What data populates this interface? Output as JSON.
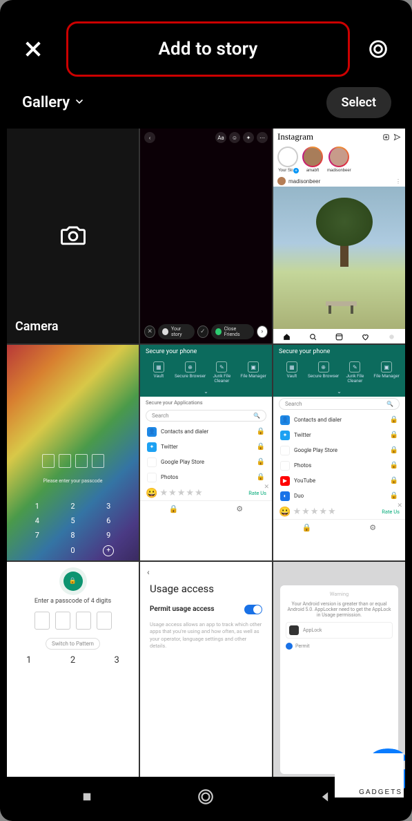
{
  "header": {
    "title": "Add to story",
    "close_icon": "close",
    "settings_icon": "settings"
  },
  "subheader": {
    "dropdown_label": "Gallery",
    "select_label": "Select"
  },
  "grid": {
    "camera": {
      "label": "Camera"
    },
    "story_editor": {
      "toolbar": [
        "Aa",
        "sticker",
        "sparkle",
        "more"
      ],
      "your_story": "Your story",
      "close_friends": "Close Friends"
    },
    "instagram_feed": {
      "brand": "Instagram",
      "icons": [
        "new-post",
        "messenger"
      ],
      "stories": [
        {
          "label": "Your Story"
        },
        {
          "label": "amabft"
        },
        {
          "label": "madisonbeer"
        }
      ],
      "post_user": "madisonbeer",
      "tabs": [
        "home",
        "search",
        "reels",
        "like",
        "profile"
      ]
    },
    "gradient_passcode": {
      "message": "Please enter your passcode",
      "keys": [
        "1",
        "2",
        "3",
        "4",
        "5",
        "6",
        "7",
        "8",
        "9",
        "",
        "0",
        "+"
      ]
    },
    "secure_a": {
      "title": "Secure your phone",
      "shortcuts": [
        {
          "label": "Vault"
        },
        {
          "label": "Secure Browser"
        },
        {
          "label": "Junk File Cleaner"
        },
        {
          "label": "File Manager"
        }
      ],
      "section": "Secure your Applications",
      "search_placeholder": "Search",
      "apps": [
        {
          "name": "Contacts and dialer",
          "color": "#1e88e5"
        },
        {
          "name": "Twitter",
          "color": "#1da1f2"
        },
        {
          "name": "Google Play Store",
          "color": "#ffffff"
        },
        {
          "name": "Photos",
          "color": "#ffffff"
        }
      ],
      "rate_label": "Rate Us"
    },
    "secure_b": {
      "title": "Secure your phone",
      "shortcuts": [
        {
          "label": "Vault"
        },
        {
          "label": "Secure Browser"
        },
        {
          "label": "Junk File Cleaner"
        },
        {
          "label": "File Manager"
        }
      ],
      "search_placeholder": "Search",
      "apps": [
        {
          "name": "Contacts and dialer",
          "color": "#1e88e5"
        },
        {
          "name": "Twitter",
          "color": "#1da1f2"
        },
        {
          "name": "Google Play Store",
          "color": "#ffffff"
        },
        {
          "name": "Photos",
          "color": "#ffffff"
        },
        {
          "name": "YouTube",
          "color": "#ff0000"
        },
        {
          "name": "Duo",
          "color": "#1a73e8"
        }
      ],
      "rate_label": "Rate Us"
    },
    "passcode_white": {
      "prompt": "Enter a passcode of 4 digits",
      "switch_label": "Switch to Pattern",
      "keys": [
        "1",
        "2",
        "3"
      ]
    },
    "usage_access": {
      "title": "Usage access",
      "row_label": "Permit usage access",
      "body": "Usage access allows an app to track which other apps that you're using and how often, as well as your operator, language settings and other details."
    },
    "dim_card": {
      "heading": "Warning",
      "body": "Your Android version is greater than or equal Android 5.0. AppLocker need to get the AppLock in Usage permission.",
      "app_label": "AppLock",
      "perm_label": "Permit"
    }
  },
  "watermark": "GADGETS"
}
